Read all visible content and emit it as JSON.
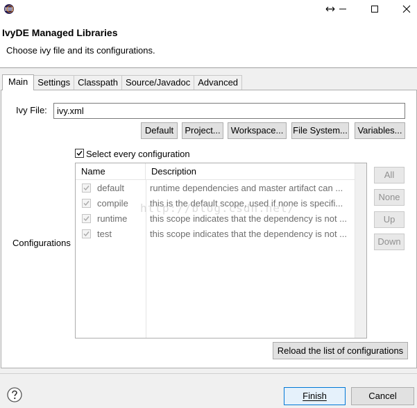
{
  "window": {
    "title": "IvyDE Managed Libraries",
    "subtitle": "Choose ivy file and its configurations.",
    "icon": "eclipse-icon",
    "controls": [
      "resize-icon",
      "minimize-icon",
      "maximize-icon",
      "close-icon"
    ]
  },
  "tabs": [
    {
      "label": "Main",
      "active": true
    },
    {
      "label": "Settings",
      "active": false
    },
    {
      "label": "Classpath",
      "active": false
    },
    {
      "label": "Source/Javadoc",
      "active": false
    },
    {
      "label": "Advanced",
      "active": false
    }
  ],
  "main": {
    "ivy_file_label": "Ivy File:",
    "ivy_file_value": "ivy.xml",
    "buttons": {
      "default": "Default",
      "project": "Project...",
      "workspace": "Workspace...",
      "file_system": "File System...",
      "variables": "Variables..."
    },
    "select_every_label": "Select every configuration",
    "select_every_checked": true,
    "configurations_label": "Configurations",
    "table": {
      "columns": [
        "Name",
        "Description"
      ],
      "rows": [
        {
          "name": "default",
          "description": "runtime dependencies and master artifact can ...",
          "checked": true
        },
        {
          "name": "compile",
          "description": "this is the default scope, used if none is specifi...",
          "checked": true
        },
        {
          "name": "runtime",
          "description": "this scope indicates that the dependency is not ...",
          "checked": true
        },
        {
          "name": "test",
          "description": "this scope indicates that the dependency is not ...",
          "checked": true
        }
      ]
    },
    "side_buttons": {
      "all": "All",
      "none": "None",
      "up": "Up",
      "down": "Down"
    },
    "reload_label": "Reload the list of configurations",
    "watermark": "http://blog.csdn.net/"
  },
  "footer": {
    "help_icon": "help-icon",
    "finish_label": "Finish",
    "cancel_label": "Cancel"
  }
}
